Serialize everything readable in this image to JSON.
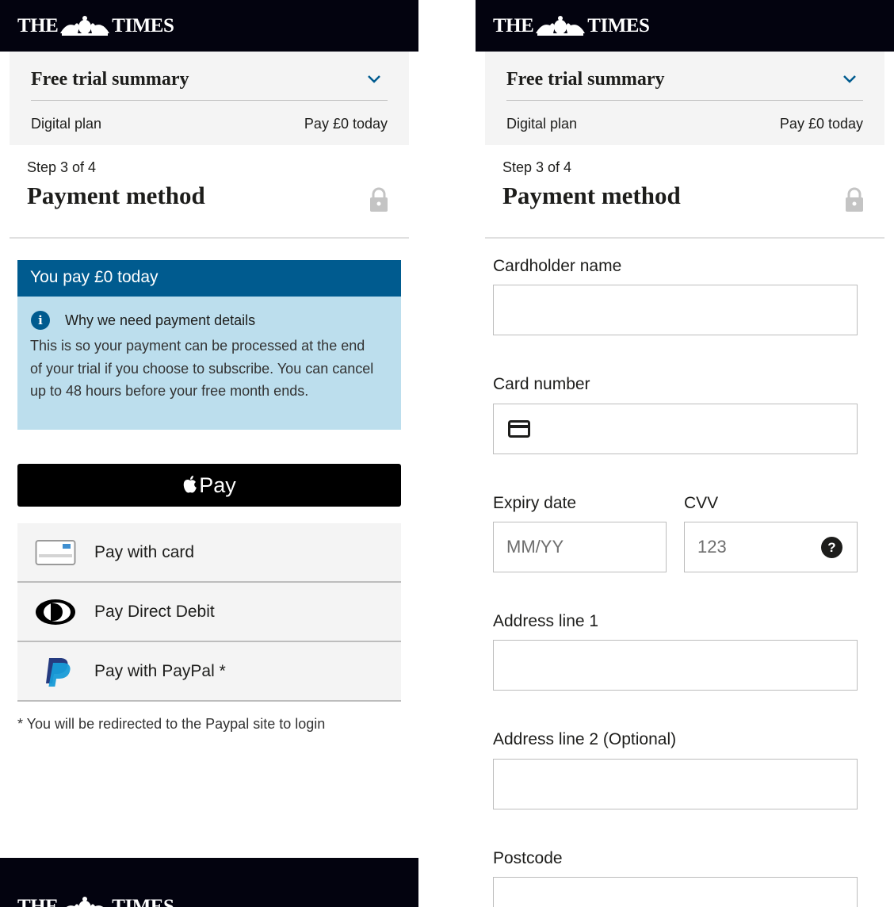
{
  "brand": {
    "logo_left": "THE",
    "logo_right": "TIMES"
  },
  "summary": {
    "title": "Free trial summary",
    "plan": "Digital plan",
    "price": "Pay £0 today"
  },
  "step": {
    "label": "Step 3 of 4",
    "heading": "Payment method"
  },
  "info": {
    "headline": "You pay £0 today",
    "why_title": "Why we need payment details",
    "description": "This is so your payment can be processed at the end of your trial if you choose to subscribe. You can cancel up to 48 hours before your free month ends."
  },
  "payment": {
    "apple_pay_label": "Pay",
    "options": [
      {
        "label": "Pay with card",
        "icon": "credit-card-icon"
      },
      {
        "label": "Pay Direct Debit",
        "icon": "direct-debit-icon"
      },
      {
        "label": "Pay with PayPal *",
        "icon": "paypal-icon"
      }
    ],
    "footnote": "* You will be redirected to the Paypal site to login"
  },
  "form": {
    "cardholder_label": "Cardholder name",
    "card_number_label": "Card number",
    "expiry_label": "Expiry date",
    "expiry_placeholder": "MM/YY",
    "cvv_label": "CVV",
    "cvv_placeholder": "123",
    "cvv_help": "?",
    "address1_label": "Address line 1",
    "address2_label": "Address line 2 (Optional)",
    "postcode_label": "Postcode"
  },
  "colors": {
    "masthead": "#03030f",
    "info_header": "#005b8f",
    "info_body": "#bcdeed",
    "summary_bg": "#f4f4f4"
  }
}
